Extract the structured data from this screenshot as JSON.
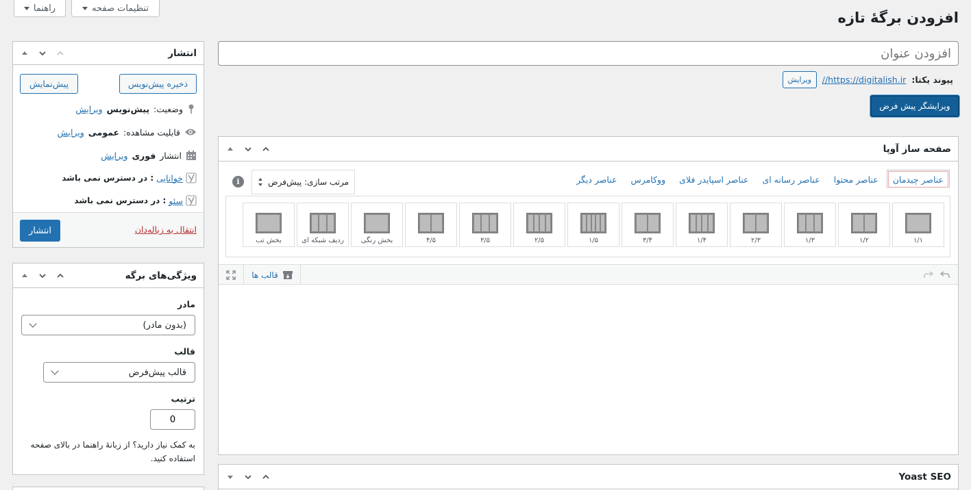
{
  "header": {
    "page_title": "افزودن برگهٔ تازه",
    "help_label": "راهنما",
    "screen_options_label": "تنظیمات صفحه"
  },
  "title_input": {
    "placeholder": "افزودن عنوان"
  },
  "permalink": {
    "label": "پیوند یکتا:",
    "url": "https://digitalish.ir//",
    "edit_label": "ویرایش"
  },
  "default_editor_button": "ویرایشگر پیش فرض",
  "page_builder": {
    "title": "صفحه ساز آوپا",
    "tabs": [
      "عناصر چیدمان",
      "عناصر محتوا",
      "عناصر رسانه ای",
      "عناصر اسپایدر فلای",
      "ووکامرس",
      "عناصر دیگر"
    ],
    "sort_label": "مرتب سازی: پیش‌فرض",
    "elements": [
      {
        "label": "۱/۱",
        "cols": 1
      },
      {
        "label": "۱/۲",
        "cols": 2
      },
      {
        "label": "۱/۳",
        "cols": 3
      },
      {
        "label": "۲/۳",
        "cols": 2
      },
      {
        "label": "۱/۴",
        "cols": 4
      },
      {
        "label": "۳/۴",
        "cols": 2
      },
      {
        "label": "۱/۵",
        "cols": 5
      },
      {
        "label": "۲/۵",
        "cols": 4
      },
      {
        "label": "۳/۵",
        "cols": 3
      },
      {
        "label": "۴/۵",
        "cols": 2
      },
      {
        "label": "بخش رنگی",
        "cols": 1
      },
      {
        "label": "ردیف شبکه ای",
        "cols": 3
      },
      {
        "label": "بخش تب",
        "cols": 1
      }
    ],
    "templates_label": "قالب ها"
  },
  "publish": {
    "title": "انتشار",
    "save_draft": "ذخیره پیش‌نویس",
    "preview": "پیش‌نمایش",
    "status_label": "وضعیت:",
    "status_value": "پیش‌نویس",
    "visibility_label": "قابلیت مشاهده:",
    "visibility_value": "عمومی",
    "publish_label": "انتشار",
    "publish_value": "فوری",
    "edit": "ویرایش",
    "readability_label": "خوانایی",
    "readability_value": ": در دسترس نمی باشد",
    "seo_label": "سئو",
    "seo_value": ": در دسترس نمی باشد",
    "trash": "انتقال به زباله‌دان",
    "publish_button": "انتشار"
  },
  "page_attributes": {
    "title": "ویژگی‌های برگه",
    "parent_label": "مادر",
    "parent_value": "(بدون مادر)",
    "template_label": "قالب",
    "template_value": "قالب پیش‌فرض",
    "order_label": "ترتیب",
    "order_value": "0",
    "help_text": "به کمک نیاز دارید؟ از زبانهٔ راهنما در بالای صفحه استفاده کنید."
  },
  "yoast": {
    "title": "Yoast SEO"
  },
  "colors": {
    "accent": "#2271b1",
    "trash": "#b32d2e"
  }
}
